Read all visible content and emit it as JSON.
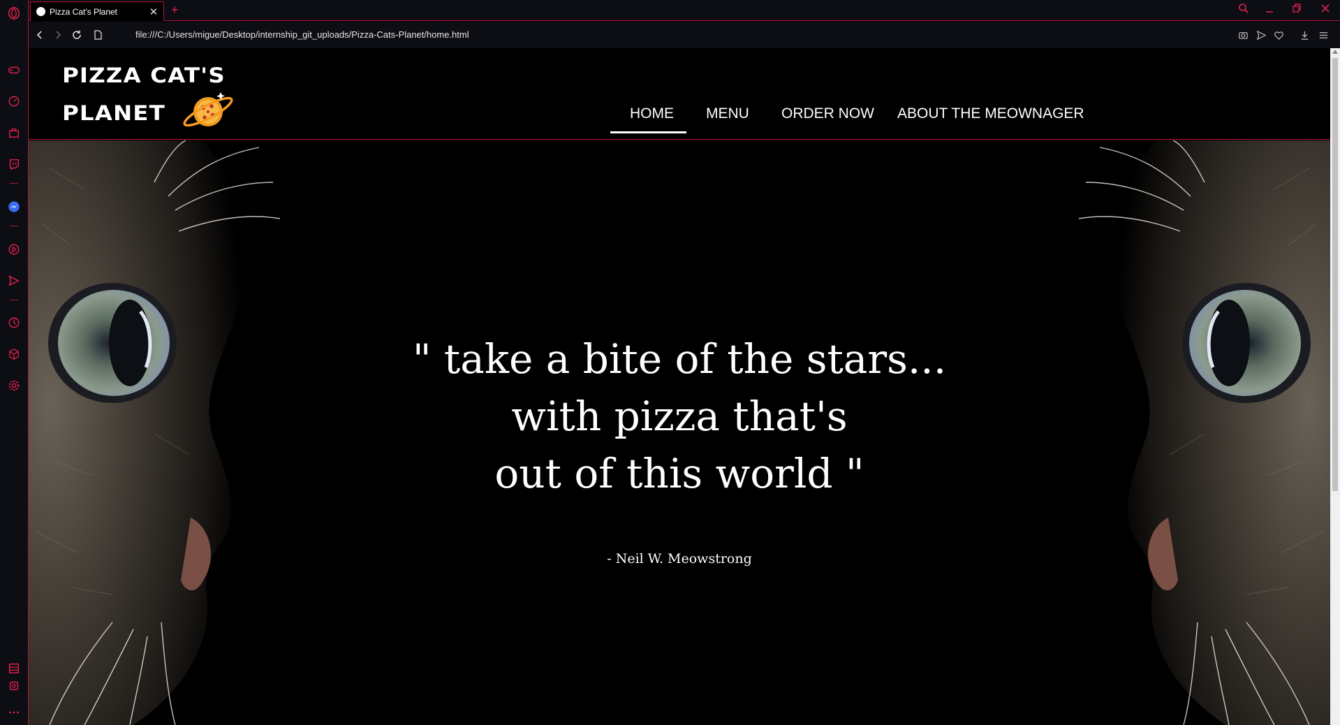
{
  "browser": {
    "tab_title": "Pizza Cat's Planet",
    "tab_close": "✕",
    "new_tab": "+",
    "url": "file:///C:/Users/migue/Desktop/internship_git_uploads/Pizza-Cats-Planet/home.html",
    "accent_color": "#e0204a"
  },
  "sidebar": {
    "icons": [
      "opera-logo-icon",
      "gamepad-icon",
      "speedometer-icon",
      "briefcase-icon",
      "twitch-icon",
      "messenger-icon",
      "player-icon",
      "send-icon",
      "history-icon",
      "cube-icon",
      "settings-icon",
      "tabs-icon",
      "snapshot-icon",
      "more-icon"
    ]
  },
  "site": {
    "logo_line1": "PIZZA CAT'S",
    "logo_line2": "PLANET",
    "nav": [
      {
        "label": "HOME",
        "active": true
      },
      {
        "label": "MENU",
        "active": false
      },
      {
        "label": "ORDER NOW",
        "active": false
      },
      {
        "label": "ABOUT THE MEOWNAGER",
        "active": false
      }
    ],
    "quote_lines": [
      "\" take a bite of the stars...",
      "with pizza that's",
      "out of this world \""
    ],
    "author": "- Neil W. Meowstrong"
  }
}
